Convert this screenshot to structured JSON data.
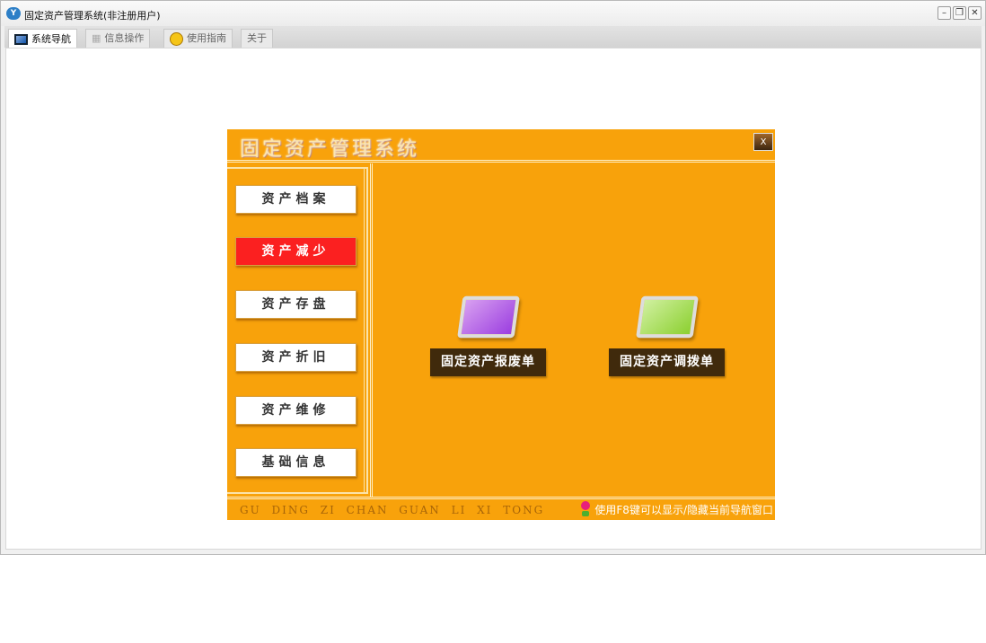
{
  "window": {
    "title": "固定资产管理系统(非注册用户)",
    "controls": [
      "minimize",
      "restore",
      "close"
    ]
  },
  "tabs": [
    {
      "label": "系统导航",
      "icon": "monitor-icon",
      "active": true
    },
    {
      "label": "信息操作",
      "icon": "grid-icon"
    },
    {
      "label": "使用指南",
      "icon": "help-icon"
    },
    {
      "label": "关于"
    }
  ],
  "panel": {
    "title": "固定资产管理系统",
    "close_label": "X",
    "nav": [
      {
        "label": "资产档案"
      },
      {
        "label": "资产减少",
        "active": true
      },
      {
        "label": "资产存盘"
      },
      {
        "label": "资产折旧"
      },
      {
        "label": "资产维修"
      },
      {
        "label": "基础信息"
      }
    ],
    "items": [
      {
        "label": "固定资产报废单",
        "icon": "purple-screen-icon",
        "color": "#9b3ee0"
      },
      {
        "label": "固定资产调拨单",
        "icon": "green-screen-icon",
        "color": "#8cd030"
      }
    ],
    "footer_pinyin": "GU DING ZI CHAN GUAN LI XI TONG",
    "footer_hint": "使用F8键可以显示/隐藏当前导航窗口"
  }
}
